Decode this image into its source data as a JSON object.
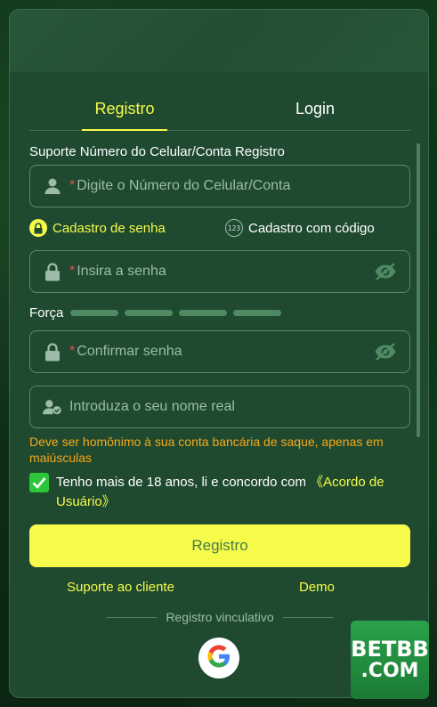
{
  "tabs": [
    {
      "label": "Registro",
      "active": true
    },
    {
      "label": "Login",
      "active": false
    }
  ],
  "form": {
    "support_label": "Suporte Número do Celular/Conta Registro",
    "phone": {
      "required_mark": "*",
      "placeholder": "Digite o Número do Celular/Conta",
      "icon": "user-icon"
    },
    "modes": [
      {
        "label": "Cadastro de senha",
        "icon": "lock-icon",
        "active": true
      },
      {
        "label": "Cadastro com código",
        "icon": "123-icon",
        "active": false
      }
    ],
    "password": {
      "required_mark": "*",
      "placeholder": "Insira a senha",
      "icon": "lock-icon"
    },
    "strength_label": "Força",
    "strength_segments": 4,
    "confirm": {
      "required_mark": "*",
      "placeholder": "Confirmar senha",
      "icon": "lock-icon"
    },
    "realname": {
      "placeholder": "Introduza o seu nome real",
      "icon": "user-check-icon"
    },
    "warning": "Deve ser homônimo à sua conta bancária de saque, apenas em maiúsculas",
    "agree_text": "Tenho mais de 18 anos, li e concordo com ",
    "agree_link": "《Acordo de Usuário》",
    "agree_checked": true,
    "submit_label": "Registro"
  },
  "links": {
    "support": "Suporte ao cliente",
    "demo": "Demo"
  },
  "divider_label": "Registro vinculativo",
  "brand": {
    "line1": "BETBB",
    "line2": ".COM"
  },
  "colors": {
    "accent": "#f6fb4a",
    "warning": "#f6a81a",
    "check": "#2cc63a",
    "panel": "#1f4a30"
  }
}
